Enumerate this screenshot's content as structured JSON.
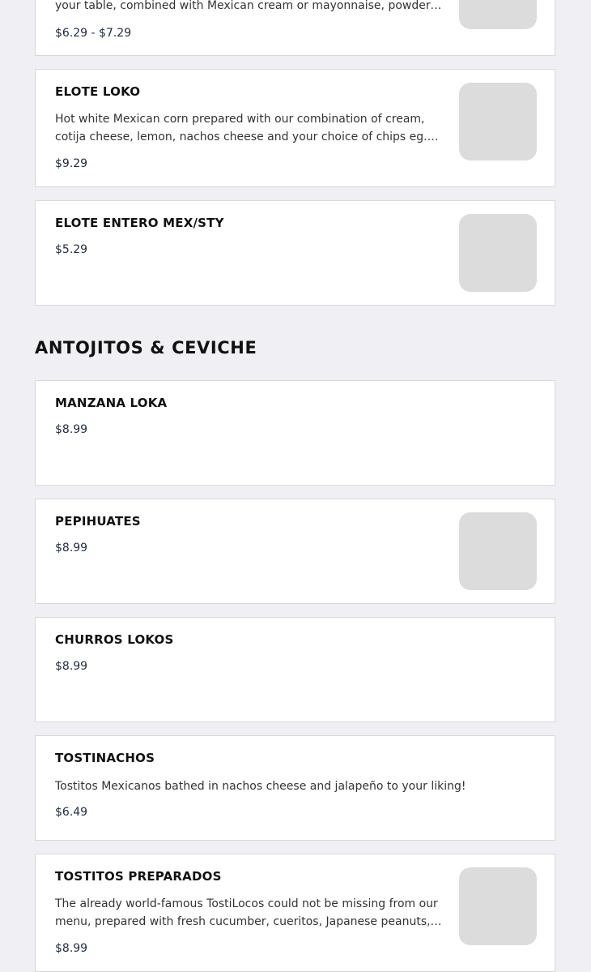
{
  "top_item": {
    "desc_tail": "your table, combined with Mexican cream or mayonnaise, powdered…",
    "price": "$6.29 - $7.29"
  },
  "elote_loko": {
    "name": "ELOTE LOKO",
    "desc": "Hot white Mexican corn prepared with our combination of cream, cotija cheese, lemon, nachos cheese and your choice of chips eg. Hot Cheto…",
    "price": "$9.29"
  },
  "elote_entero": {
    "name": "ELOTE ENTERO MEX/STY",
    "price": "$5.29"
  },
  "section": {
    "title": "ANTOJITOS & CEVICHE"
  },
  "manzana_loka": {
    "name": "MANZANA LOKA",
    "price": "$8.99"
  },
  "pepihuates": {
    "name": "PEPIHUATES",
    "price": "$8.99"
  },
  "churros_lokos": {
    "name": "CHURROS LOKOS",
    "price": "$8.99"
  },
  "tostinachos": {
    "name": "TOSTINACHOS",
    "desc": "Tostitos Mexicanos bathed in nachos cheese and jalapeño to your liking!",
    "price": "$6.49"
  },
  "tostitos_preparados": {
    "name": "TOSTITOS PREPARADOS",
    "desc": "The already world-famous TostiLocos could not be missing from our menu, prepared with fresh cucumber, cueritos, Japanese peanuts,…",
    "price": "$8.99"
  }
}
